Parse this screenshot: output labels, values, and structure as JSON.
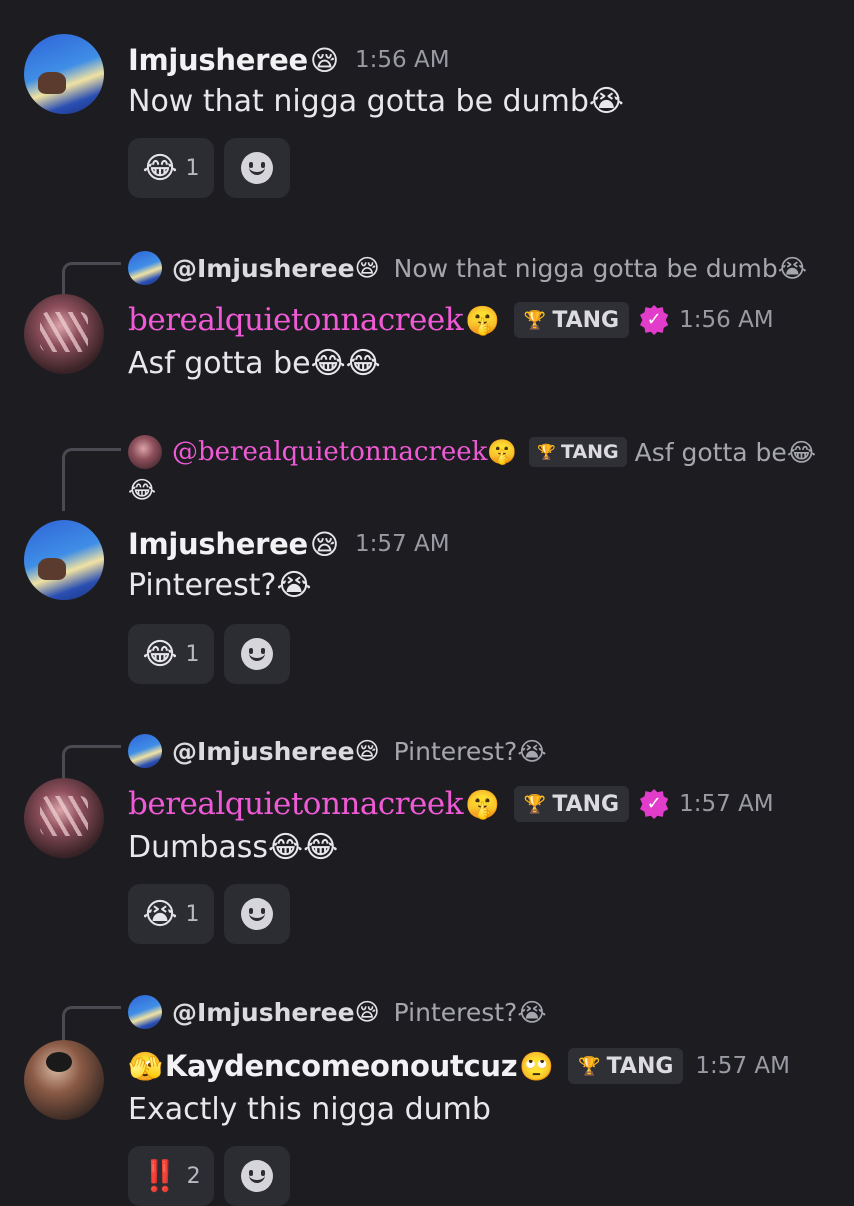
{
  "messages": [
    {
      "author": "Imjusheree",
      "author_emoji": "😪",
      "time": "1:56 AM",
      "text": "Now that nigga gotta be dumb",
      "text_emoji": "😭",
      "reaction": {
        "emoji": "😂",
        "count": "1"
      }
    },
    {
      "reply": {
        "name": "@Imjusheree",
        "name_emoji": "😪",
        "text": "Now that nigga gotta be dumb",
        "text_emoji": "😭"
      },
      "author": "berealquietonnacreek",
      "author_emoji": "🤫",
      "badge": "TANG",
      "badge_icon": "🏆",
      "time": "1:56 AM",
      "text": "Asf gotta be",
      "text_emoji": "😂😂"
    },
    {
      "reply": {
        "name": "@berealquietonnacreek",
        "name_emoji": "🤫",
        "badge": "TANG",
        "badge_icon": "🏆",
        "text": "Asf gotta be",
        "text_emoji": "😂",
        "text_line2": "😂"
      },
      "author": "Imjusheree",
      "author_emoji": "😪",
      "time": "1:57 AM",
      "text": "Pinterest?",
      "text_emoji": "😭",
      "reaction": {
        "emoji": "😂",
        "count": "1"
      }
    },
    {
      "reply": {
        "name": "@Imjusheree",
        "name_emoji": "😪",
        "text": "Pinterest?",
        "text_emoji": "😭"
      },
      "author": "berealquietonnacreek",
      "author_emoji": "🤫",
      "badge": "TANG",
      "badge_icon": "🏆",
      "time": "1:57 AM",
      "text": "Dumbass",
      "text_emoji": "😂😂",
      "reaction": {
        "emoji": "😭",
        "count": "1"
      }
    },
    {
      "reply": {
        "name": "@Imjusheree",
        "name_emoji": "😪",
        "text": "Pinterest?",
        "text_emoji": "😭"
      },
      "author_prefix_emoji": "🫣",
      "author": "Kaydencomeonoutcuz",
      "author_emoji": "🙄",
      "badge": "TANG",
      "badge_icon": "🏆",
      "time": "1:57 AM",
      "text": "Exactly this nigga dumb",
      "reaction": {
        "emoji": "‼️",
        "count": "2"
      }
    }
  ],
  "colors": {
    "background": "#1c1c21",
    "pink_name": "#f05ad6",
    "verified": "#e23ccb",
    "reaction_bg": "#2c2c33"
  },
  "icons": {
    "verified": "verified-badge-icon",
    "add_reaction": "add-reaction-smile-icon",
    "badge": "trophy-icon"
  }
}
